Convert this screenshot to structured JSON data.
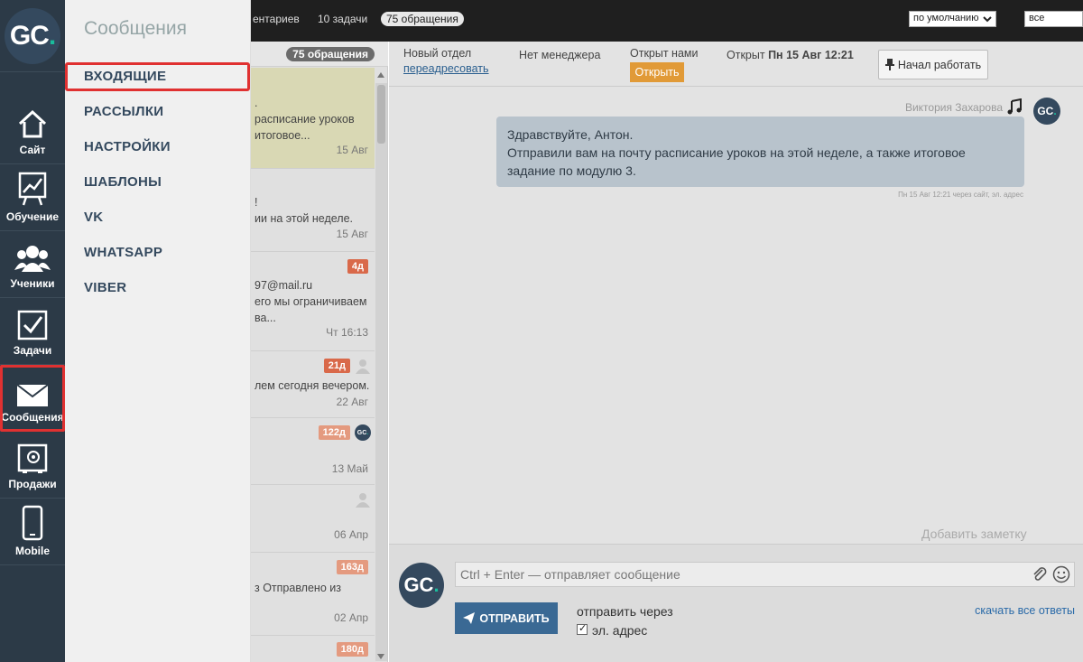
{
  "logo": {
    "text": "GC",
    "dot": "."
  },
  "nav": [
    {
      "label": "Сайт",
      "icon": "home-icon"
    },
    {
      "label": "Обучение",
      "icon": "chart-board-icon"
    },
    {
      "label": "Ученики",
      "icon": "users-icon"
    },
    {
      "label": "Задачи",
      "icon": "checkbox-icon"
    },
    {
      "label": "Сообщения",
      "icon": "envelope-icon",
      "active": true
    },
    {
      "label": "Продажи",
      "icon": "safe-icon"
    },
    {
      "label": "Mobile",
      "icon": "phone-icon"
    }
  ],
  "submenu": {
    "title": "Сообщения",
    "items": [
      "ВХОДЯЩИЕ",
      "РАССЫЛКИ",
      "НАСТРОЙКИ",
      "ШАБЛОНЫ",
      "VK",
      "WHATSAPP",
      "VIBER"
    ],
    "active_index": 0
  },
  "topbar": {
    "comments": "ентариев",
    "tasks": "10 задачи",
    "requests": "75 обращения",
    "sort_value": "по умолчанию",
    "filter_value": "все"
  },
  "list": {
    "count": "75 обращения",
    "items": [
      {
        "lines": [
          ".",
          "расписание уроков",
          "итоговое..."
        ],
        "date": "15 Авг"
      },
      {
        "lines": [
          "!",
          "ии на этой неделе."
        ],
        "date": "15 Авг"
      },
      {
        "tag": "4д",
        "lines": [
          "97@mail.ru",
          "его мы ограничиваем",
          "ва..."
        ],
        "date": "Чт 16:13"
      },
      {
        "tag": "21д",
        "lines": [
          "лем сегодня вечером."
        ],
        "date": "22 Авг"
      },
      {
        "tag": "122д",
        "lines": [],
        "date": "13 Май"
      },
      {
        "tag": "",
        "lines": [],
        "date": "06 Апр"
      },
      {
        "tag": "163д",
        "lines": [
          "з Отправлено из"
        ],
        "date": "02 Апр"
      },
      {
        "tag": "180д",
        "lines": [],
        "date": ""
      }
    ]
  },
  "header": {
    "department": "Новый отдел",
    "redirect_link": "переадресовать",
    "manager": "Нет менеджера",
    "opened_by": "Открыт нами",
    "open_button": "Открыть",
    "opened_label": "Открыт",
    "opened_date": "Пн 15 Авг 12:21",
    "start_button": "Начал работать"
  },
  "message": {
    "sender": "Виктория Захарова",
    "lines": [
      "Здравствуйте, Антон.",
      "Отправили вам на почту расписание уроков на этой неделе, а также итоговое",
      "задание по модулю 3."
    ],
    "meta": "Пн 15 Авг 12:21 через сайт, эл. адрес"
  },
  "add_note": "Добавить заметку",
  "composer": {
    "placeholder": "Ctrl + Enter — отправляет сообщение",
    "send_button": "ОТПРАВИТЬ",
    "send_via": "отправить через",
    "channel": "эл. адрес",
    "download_all": "скачать все ответы"
  },
  "colors": {
    "sidebar": "#2c3a47",
    "accent_teal": "#1abc9c",
    "highlight_red": "#e03131",
    "open_button": "#e19a37",
    "send_button": "#3a6994"
  }
}
